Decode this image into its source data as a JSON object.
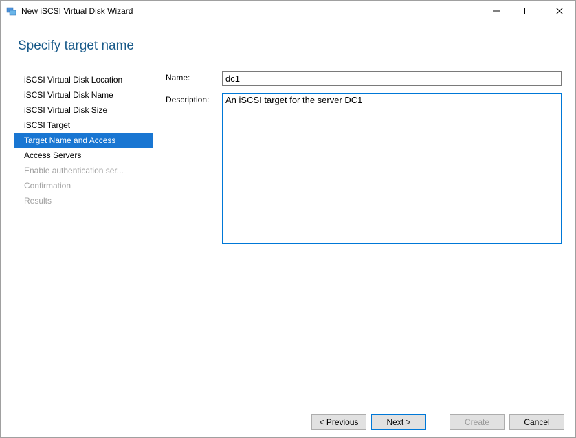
{
  "window": {
    "title": "New iSCSI Virtual Disk Wizard"
  },
  "heading": "Specify target name",
  "steps": [
    {
      "label": "iSCSI Virtual Disk Location",
      "state": "done"
    },
    {
      "label": "iSCSI Virtual Disk Name",
      "state": "done"
    },
    {
      "label": "iSCSI Virtual Disk Size",
      "state": "done"
    },
    {
      "label": "iSCSI Target",
      "state": "done"
    },
    {
      "label": "Target Name and Access",
      "state": "current"
    },
    {
      "label": "Access Servers",
      "state": "done"
    },
    {
      "label": "Enable authentication ser...",
      "state": "future"
    },
    {
      "label": "Confirmation",
      "state": "future"
    },
    {
      "label": "Results",
      "state": "future"
    }
  ],
  "form": {
    "name_label": "Name:",
    "name_value": "dc1",
    "desc_label": "Description:",
    "desc_value": "An iSCSI target for the server DC1"
  },
  "buttons": {
    "previous": "< Previous",
    "next": "Next >",
    "create": "Create",
    "cancel": "Cancel"
  }
}
